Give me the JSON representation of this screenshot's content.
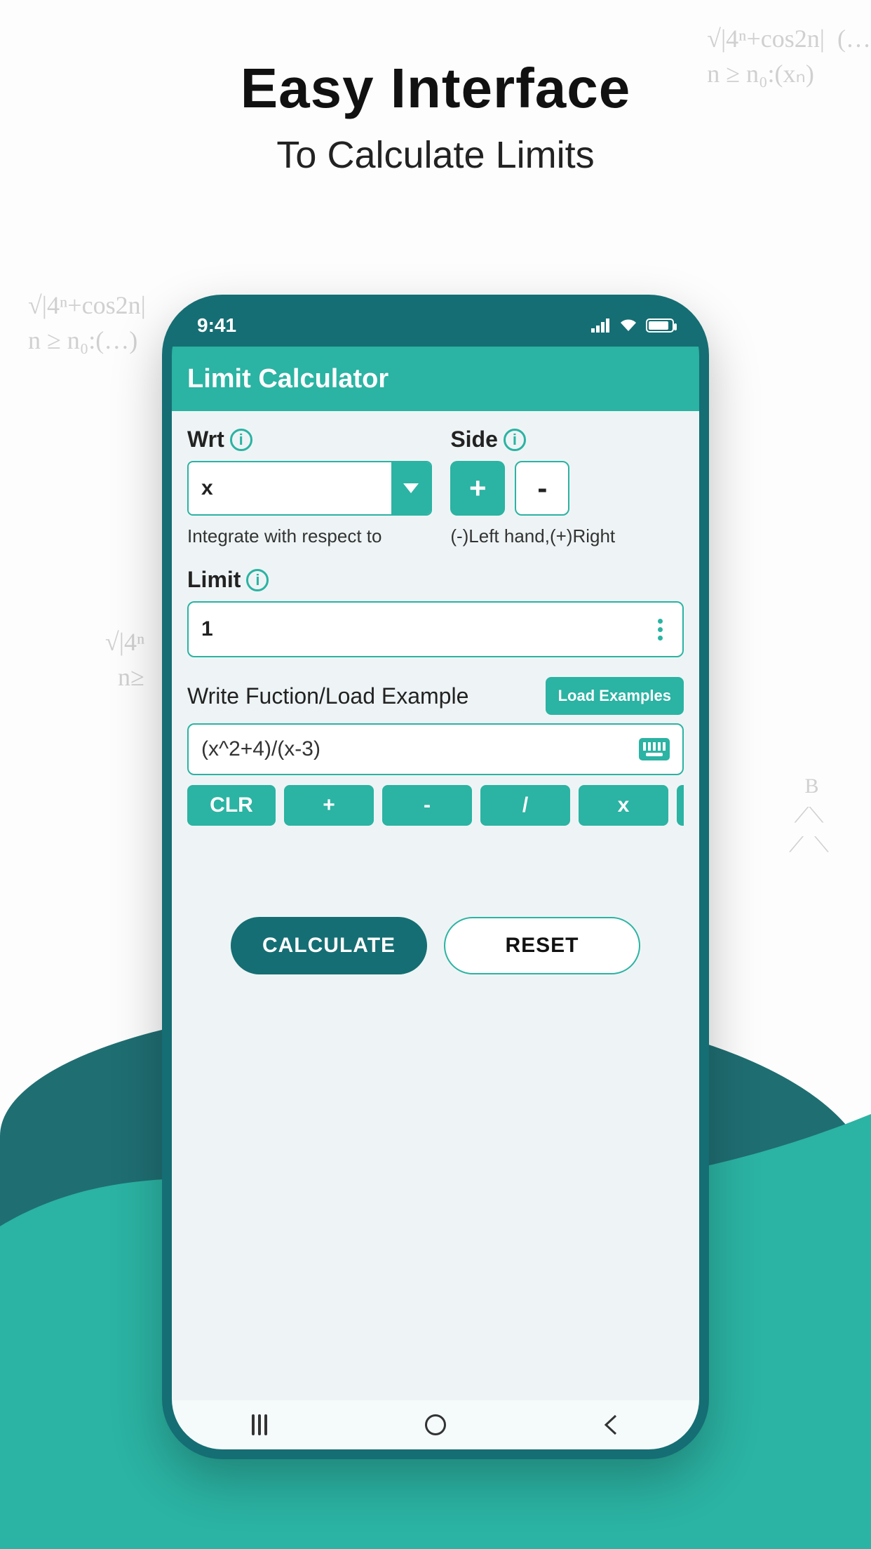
{
  "promo": {
    "title": "Easy Interface",
    "subtitle": "To Calculate Limits"
  },
  "status": {
    "time": "9:41"
  },
  "appbar": {
    "title": "Limit Calculator"
  },
  "wrt": {
    "label": "Wrt",
    "value": "x",
    "hint": "Integrate with respect to"
  },
  "side": {
    "label": "Side",
    "plus": "+",
    "minus": "-",
    "hint": "(-)Left hand,(+)Right"
  },
  "limit": {
    "label": "Limit",
    "value": "1"
  },
  "func": {
    "label": "Write Fuction/Load Example",
    "load_btn": "Load Examples",
    "value": "(x^2+4)/(x-3)"
  },
  "toolbar": [
    "CLR",
    "+",
    "-",
    "/",
    "x"
  ],
  "actions": {
    "calculate": "CALCULATE",
    "reset": "RESET"
  }
}
